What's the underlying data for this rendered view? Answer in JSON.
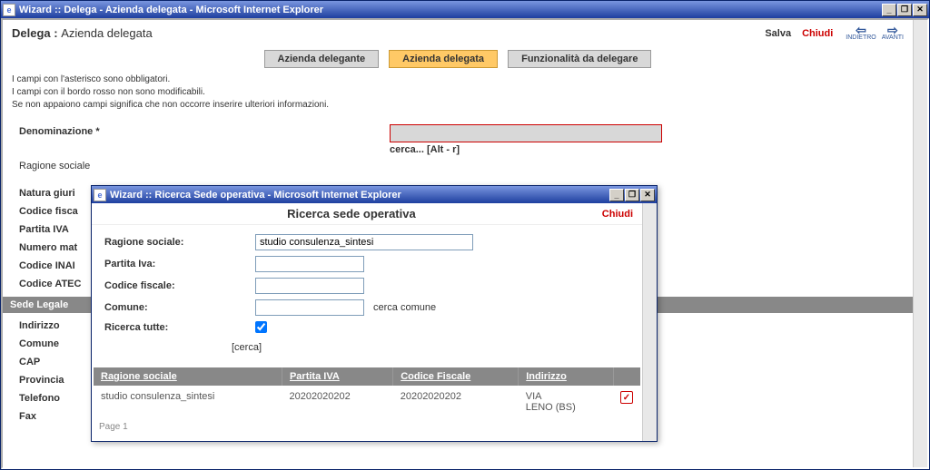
{
  "outer_window": {
    "title": "Wizard :: Delega - Azienda delegata - Microsoft Internet Explorer"
  },
  "page": {
    "heading": "Delega :",
    "subheading": "Azienda delegata",
    "actions": {
      "save": "Salva",
      "close": "Chiudi",
      "back": "INDIETRO",
      "forward": "AVANTI"
    },
    "tabs": {
      "delegante": "Azienda delegante",
      "delegata": "Azienda delegata",
      "funzionalita": "Funzionalità da delegare"
    },
    "help": {
      "l1": "I campi con l'asterisco sono obbligatori.",
      "l2": "I campi con il bordo rosso non sono modificabili.",
      "l3": "Se non appaiono campi significa che non occorre inserire ulteriori informazioni."
    },
    "fields": {
      "denominazione": "Denominazione *",
      "cerca_hint": "cerca... [Alt - r]",
      "ragione_sociale": "Ragione sociale",
      "natura": "Natura giuri",
      "codice_fiscale": "Codice fisca",
      "partita_iva": "Partita IVA",
      "numero_mat": "Numero mat",
      "codice_inai": "Codice INAI",
      "codice_atec": "Codice ATEC",
      "indirizzo": "Indirizzo",
      "comune": "Comune",
      "cap": "CAP",
      "provincia": "Provincia",
      "telefono": "Telefono",
      "fax": "Fax"
    },
    "section_sede": "Sede Legale"
  },
  "dialog": {
    "window_title": "Wizard :: Ricerca Sede operativa - Microsoft Internet Explorer",
    "title": "Ricerca sede operativa",
    "close": "Chiudi",
    "form": {
      "ragione_sociale_lbl": "Ragione sociale:",
      "ragione_sociale_val": "studio consulenza_sintesi",
      "partita_iva_lbl": "Partita Iva:",
      "codice_fiscale_lbl": "Codice fiscale:",
      "comune_lbl": "Comune:",
      "cerca_comune": "cerca comune",
      "ricerca_tutte_lbl": "Ricerca tutte:",
      "cerca": "[cerca]"
    },
    "table": {
      "headers": {
        "rs": "Ragione sociale",
        "piva": "Partita IVA",
        "cf": "Codice Fiscale",
        "indirizzo": "Indirizzo"
      },
      "row": {
        "rs": "studio consulenza_sintesi",
        "piva": "20202020202",
        "cf": "20202020202",
        "ind1": "VIA",
        "ind2": "LENO (BS)"
      }
    },
    "pager": "Page 1"
  }
}
